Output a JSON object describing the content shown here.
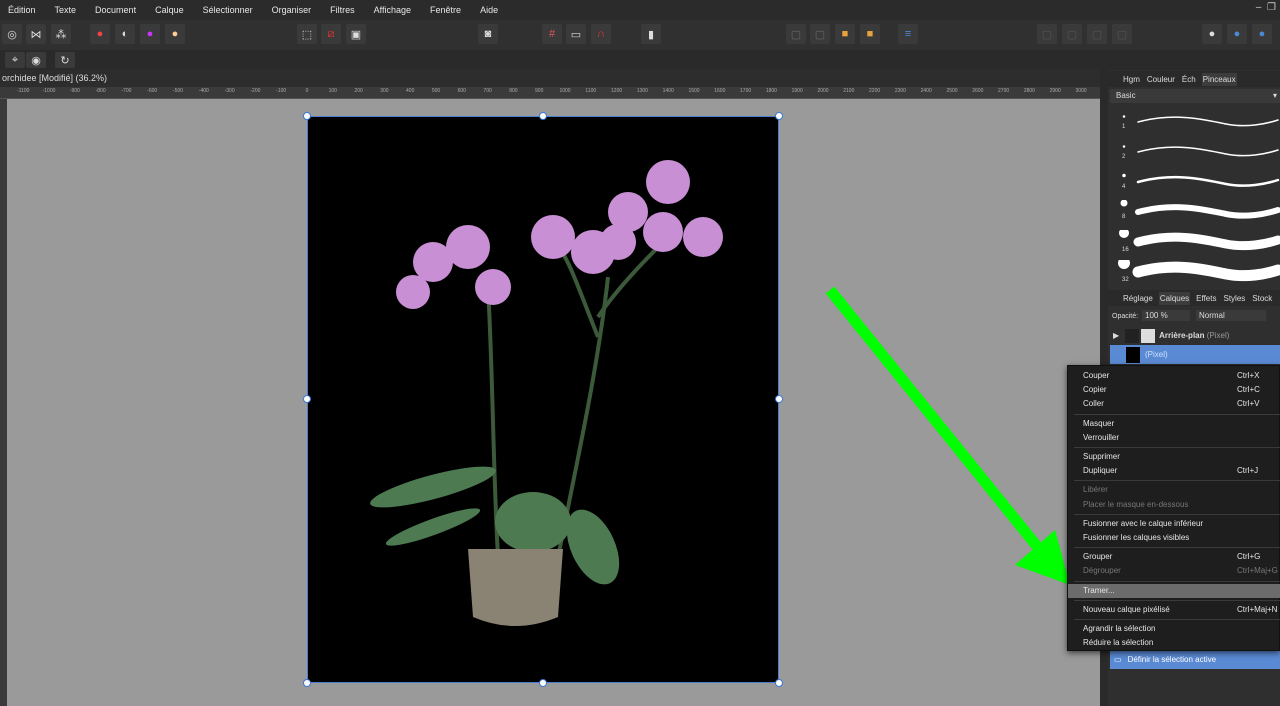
{
  "menu": [
    "Édition",
    "Texte",
    "Document",
    "Calque",
    "Sélectionner",
    "Organiser",
    "Filtres",
    "Affichage",
    "Fenêtre",
    "Aide"
  ],
  "document_title": "orchidee [Modifié] (36.2%)",
  "ruler_labels": [
    -1100,
    -1000,
    -900,
    -800,
    -700,
    -600,
    -500,
    -400,
    -300,
    -200,
    -100,
    0,
    100,
    200,
    300,
    400,
    500,
    600,
    700,
    800,
    900,
    1000,
    1100,
    1200,
    1300,
    1400,
    1500,
    1600,
    1700,
    1800,
    1900,
    2000,
    2100,
    2200,
    2300,
    2400,
    2500,
    2600,
    2700,
    2800,
    2900,
    3000
  ],
  "top_panel": {
    "tabs": [
      "Hgm",
      "Couleur",
      "Éch",
      "Pinceaux"
    ],
    "active_tab": "Pinceaux",
    "category": "Basic",
    "brush_sizes": [
      "1",
      "2",
      "4",
      "8",
      "16",
      "32"
    ]
  },
  "layers_panel": {
    "tabs": [
      "Réglage",
      "Calques",
      "Effets",
      "Styles",
      "Stock"
    ],
    "active_tab": "Calques",
    "opacity_label": "Opacité:",
    "opacity": "100 %",
    "blend_mode": "Normal",
    "layers": [
      {
        "name": "Arrière-plan",
        "type": "(Pixel)"
      },
      {
        "name": "",
        "type": "(Pixel)"
      }
    ],
    "action": "Définir la sélection active"
  },
  "context_menu": {
    "groups": [
      [
        {
          "label": "Couper",
          "shortcut": "Ctrl+X"
        },
        {
          "label": "Copier",
          "shortcut": "Ctrl+C"
        },
        {
          "label": "Coller",
          "shortcut": "Ctrl+V"
        }
      ],
      [
        {
          "label": "Masquer",
          "shortcut": ""
        },
        {
          "label": "Verrouiller",
          "shortcut": ""
        }
      ],
      [
        {
          "label": "Supprimer",
          "shortcut": ""
        },
        {
          "label": "Dupliquer",
          "shortcut": "Ctrl+J"
        }
      ],
      [
        {
          "label": "Libérer",
          "shortcut": "",
          "disabled": true
        },
        {
          "label": "Placer le masque en-dessous",
          "shortcut": "",
          "disabled": true
        }
      ],
      [
        {
          "label": "Fusionner avec le calque inférieur",
          "shortcut": ""
        },
        {
          "label": "Fusionner les calques visibles",
          "shortcut": ""
        }
      ],
      [
        {
          "label": "Grouper",
          "shortcut": "Ctrl+G"
        },
        {
          "label": "Dégrouper",
          "shortcut": "Ctrl+Maj+G",
          "disabled": true
        }
      ],
      [
        {
          "label": "Tramer...",
          "shortcut": "",
          "highlighted": true
        }
      ],
      [
        {
          "label": "Nouveau calque pixélisé",
          "shortcut": "Ctrl+Maj+N"
        }
      ],
      [
        {
          "label": "Agrandir la sélection",
          "shortcut": ""
        },
        {
          "label": "Réduire la sélection",
          "shortcut": ""
        }
      ]
    ]
  },
  "colors": {
    "accent": "#5a8ad4",
    "arrow": "#00ff00",
    "selection": "#3a78d4"
  }
}
